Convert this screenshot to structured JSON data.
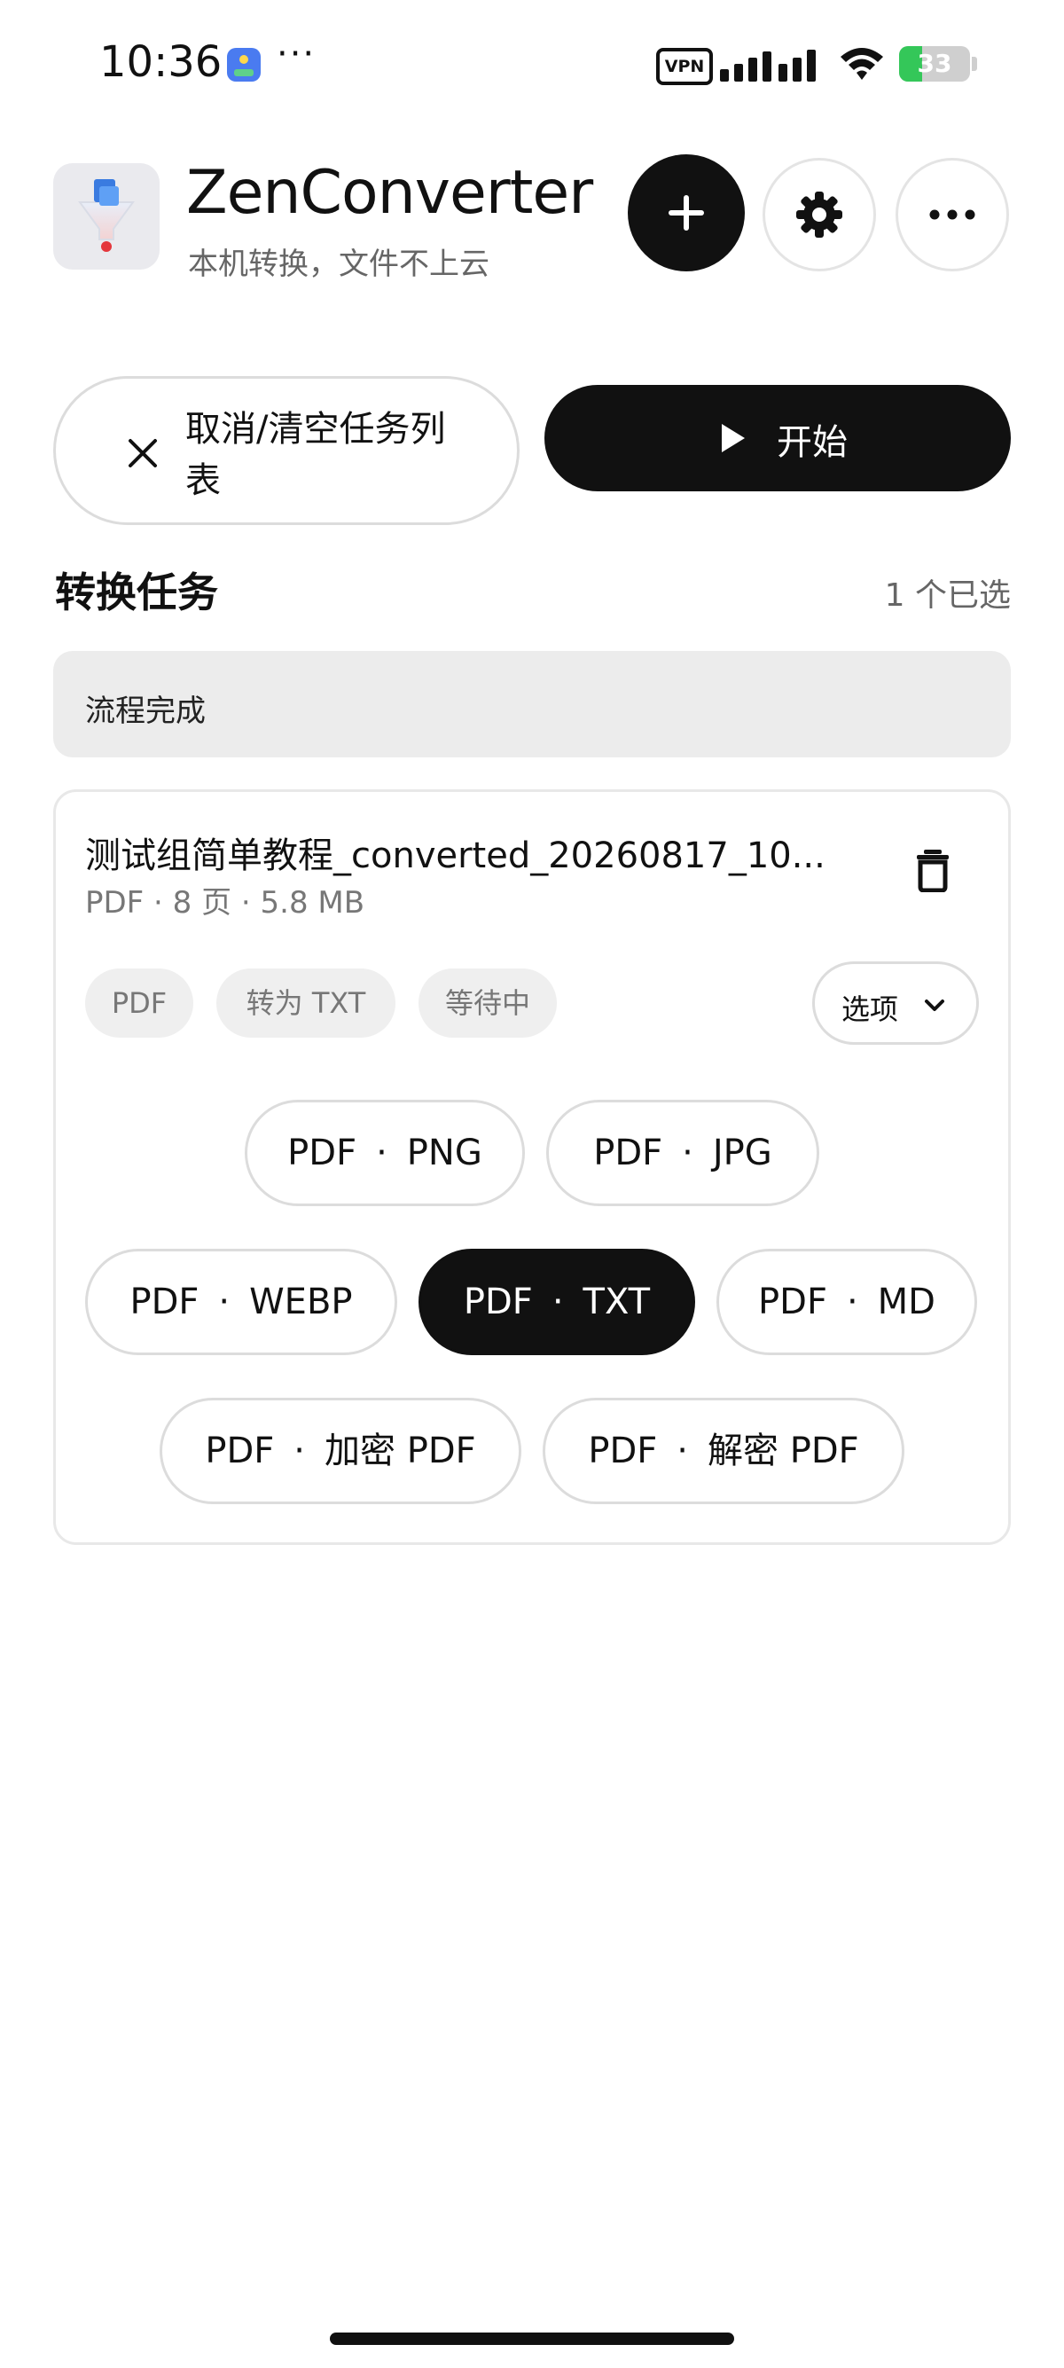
{
  "status_bar": {
    "time": "10:36",
    "dots": "···",
    "vpn": "VPN",
    "battery": "33",
    "icons": [
      "app-notification-icon",
      "vpn-icon",
      "signal-icon",
      "wifi-icon",
      "battery-icon"
    ]
  },
  "header": {
    "title": "ZenConverter",
    "subtitle": "本机转换，文件不上云",
    "logo_icon": "funnel-logo-icon",
    "buttons": [
      "add-icon",
      "gear-icon",
      "more-icon"
    ]
  },
  "actions": {
    "cancel_label": "取消/清空任务列表",
    "start_label": "开始"
  },
  "section": {
    "title": "转换任务",
    "count": "1 个已选"
  },
  "status_message": "流程完成",
  "task": {
    "file_name": "测试组简单教程_converted_20260817_10...",
    "meta": "PDF · 8 页 · 5.8 MB",
    "chips": {
      "source": "PDF",
      "target": "转为 TXT",
      "status": "等待中"
    },
    "options_label": "选项",
    "formats": [
      {
        "from": "PDF",
        "to": "PNG",
        "selected": false
      },
      {
        "from": "PDF",
        "to": "JPG",
        "selected": false
      },
      {
        "from": "PDF",
        "to": "WEBP",
        "selected": false
      },
      {
        "from": "PDF",
        "to": "TXT",
        "selected": true
      },
      {
        "from": "PDF",
        "to": "MD",
        "selected": false
      },
      {
        "from": "PDF",
        "to": "加密 PDF",
        "selected": false
      },
      {
        "from": "PDF",
        "to": "解密 PDF",
        "selected": false
      }
    ],
    "format_separator": "·"
  },
  "colors": {
    "primary": "#111111",
    "muted_text": "#666666",
    "chip_bg": "#efefef",
    "battery_green": "#34c759"
  }
}
